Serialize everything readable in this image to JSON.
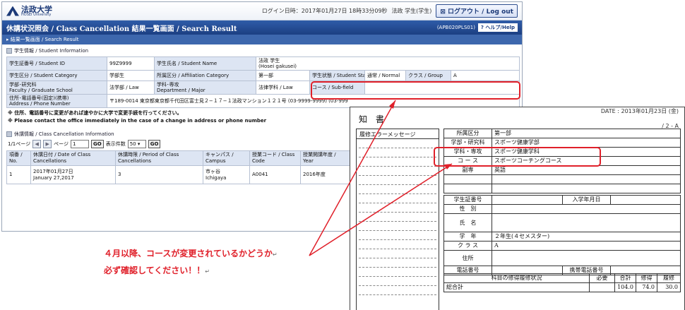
{
  "header": {
    "univ_name": "法政大学",
    "univ_sub": "HOSEI University",
    "login_time": "ログイン日時：2017年01月27日 18時33分09秒",
    "user": "法政 学生(学生)",
    "logout": "ログアウト / Log out"
  },
  "titlebar": {
    "title": "休講状況照会 / Class Cancellation  結果一覧画面 / Search Result",
    "screen_id": "(APB020PLS01)",
    "help": "ヘルプ/Help"
  },
  "breadcrumb": "結果一覧画面 / Search Result",
  "student_section": {
    "heading": "学生情報 / Student Information",
    "student_id_label": "学生証番号 / Student ID",
    "student_id": "99Z9999",
    "name_label": "学生氏名 / Student Name",
    "name_jp": "法政 学生",
    "name_en": "(Hosei gakusei)",
    "category_label": "学生区分 / Student Category",
    "category": "学部生",
    "affiliation_label": "所属区分 / Affiliation Category",
    "affiliation": "第一部",
    "status_label": "学生状態 / Student Status",
    "status": "通常 / Normal",
    "class_label": "クラス / Group",
    "class_value": "A",
    "faculty_label_1": "学部･研究科",
    "faculty_label_2": "Faculty / Graduate School",
    "faculty": "法学部 / Law",
    "dept_label_1": "学科･専攻",
    "dept_label_2": "Department / Major",
    "dept": "法律学科 / Law",
    "course_label": "コース / Sub-field",
    "course": "",
    "address_label_1": "住所･電話番号(固定)(携帯)",
    "address_label_2": "Address / Phone Number",
    "address": "〒189-0014  東京都東京都千代田区富士見２−１７−１法政マンション１２１号  (03-9999-9999)  (03-999"
  },
  "notice": {
    "jp": "※ 住所、電話番号に変更があれば速やかに大学で変更手続を行ってください。",
    "en": "※ Please contact the office immediately in the case of a change in address or phone number"
  },
  "cancel_section": {
    "heading": "休講情報 / Class Cancellation Information",
    "page_indicator": "1/1ページ",
    "page_label": "ページ",
    "page_value": "1",
    "go": "GO",
    "display_count_label": "表示件数",
    "display_count": "50",
    "headers": [
      [
        "項番 /",
        "No."
      ],
      [
        "休講日付 / Date of Class",
        "Cancellations"
      ],
      [
        "休講時限 / Period of Class",
        "Cancellations"
      ],
      [
        "キャンパス /",
        "Campus"
      ],
      [
        "授業コード / Class",
        "Code"
      ],
      [
        "授業開講年度 /",
        "Year"
      ]
    ],
    "rows": [
      [
        "1",
        "2017年01月27日",
        "January 27,2017",
        "3",
        "市ヶ谷",
        "Ichigaya",
        "A0041",
        "2016年度"
      ]
    ]
  },
  "document": {
    "title": "知 書",
    "top_text": "DATE :  2013年01月23日 (金)",
    "page": "/ 2 - A",
    "error_header": "履修エラーメッセージ",
    "table1": [
      [
        "所属区分",
        "第一部"
      ],
      [
        "学部・研究科",
        "スポーツ健康学部"
      ],
      [
        "学科・専攻",
        "スポーツ健康学科"
      ],
      [
        "コ ー ス",
        "スポーツコーチングコース"
      ],
      [
        "副専",
        "英語"
      ],
      [
        "",
        ""
      ],
      [
        "",
        ""
      ]
    ],
    "table2": {
      "student_no": "学生証番号",
      "admit_year": "入学年月日",
      "gender": "性　別",
      "name": "氏　名",
      "grade": "学　年",
      "grade_value": "２年生(４セメスター)",
      "class": "ク ラ ス",
      "class_value": "A",
      "address": "住所",
      "phone": "電話番号",
      "mobile": "携帯電話番号"
    },
    "table3": {
      "header": "科目の修得履修状況",
      "cols": [
        "必要",
        "合計",
        "修得",
        "履修"
      ],
      "total_label": "総合計",
      "total": [
        "",
        "104.0",
        "74.0",
        "30.0"
      ]
    }
  },
  "annotation": {
    "line1": "４月以降、コースが変更されているかどうか",
    "line2": "必ず確認してください！！",
    "return_mark": "↵"
  },
  "colors": {
    "accent": "#e0202a",
    "nav": "#1c3f82"
  }
}
